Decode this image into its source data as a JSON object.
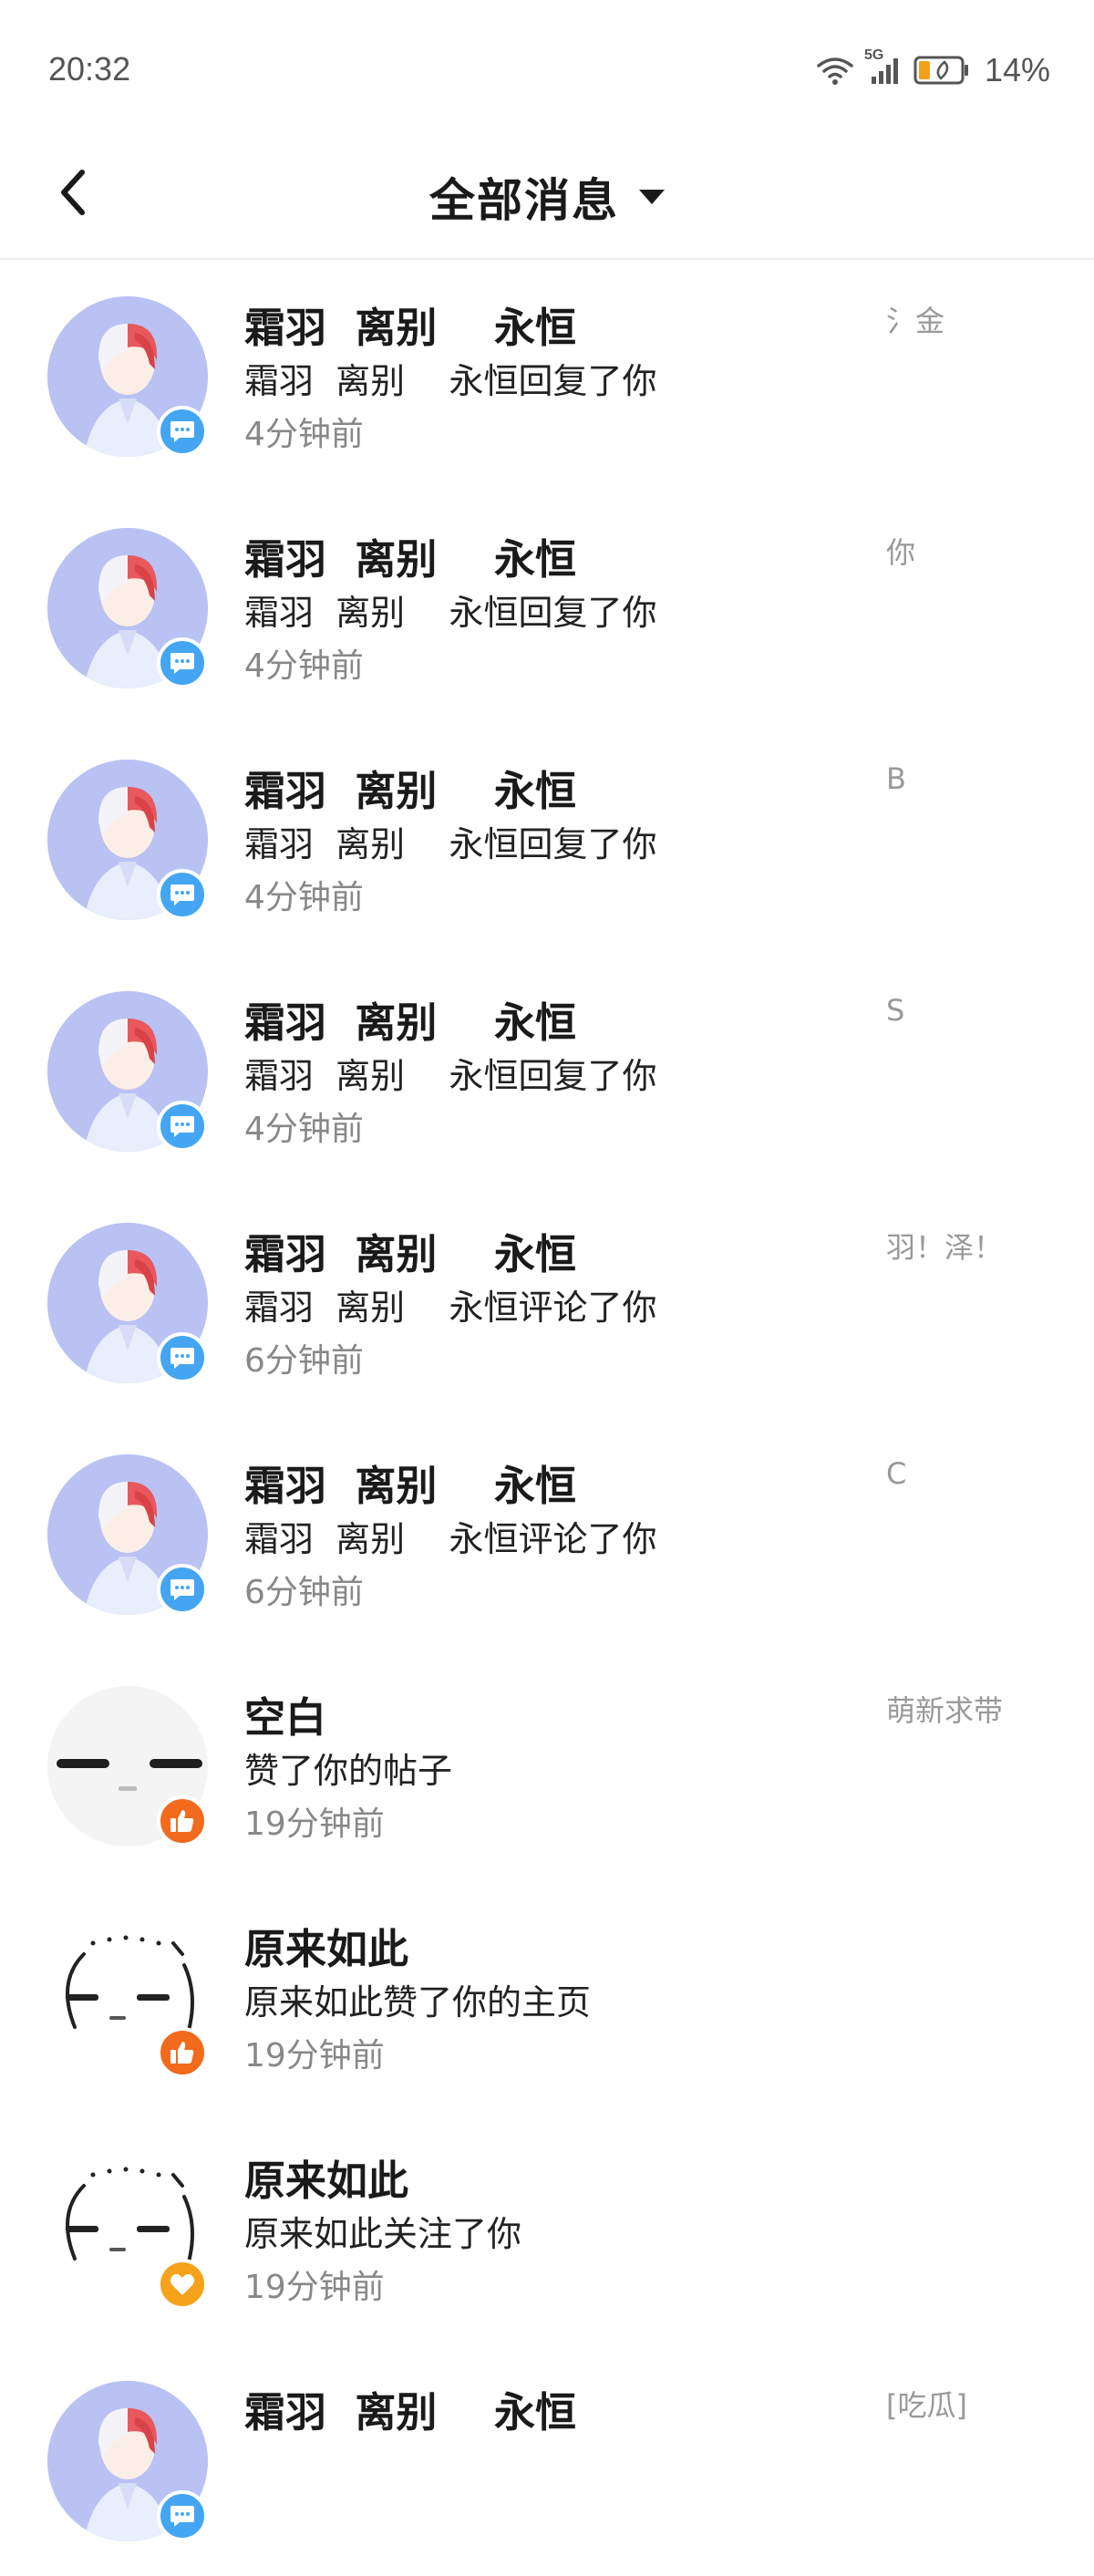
{
  "status_bar": {
    "time": "20:32",
    "network": "5G",
    "battery": "14%"
  },
  "header": {
    "title": "全部消息",
    "back_icon": "chevron-left-icon",
    "caret_icon": "caret-down-icon"
  },
  "messages": [
    {
      "name": "霜羽  离别    永恒",
      "action": "霜羽  离别    永恒回复了你",
      "time": "4分钟前",
      "preview": "氵金",
      "avatar": "anime",
      "badge": "comment"
    },
    {
      "name": "霜羽  离别    永恒",
      "action": "霜羽  离别    永恒回复了你",
      "time": "4分钟前",
      "preview": "你",
      "avatar": "anime",
      "badge": "comment"
    },
    {
      "name": "霜羽  离别    永恒",
      "action": "霜羽  离别    永恒回复了你",
      "time": "4分钟前",
      "preview": "B",
      "avatar": "anime",
      "badge": "comment"
    },
    {
      "name": "霜羽  离别    永恒",
      "action": "霜羽  离别    永恒回复了你",
      "time": "4分钟前",
      "preview": "S",
      "avatar": "anime",
      "badge": "comment"
    },
    {
      "name": "霜羽  离别    永恒",
      "action": "霜羽  离别    永恒评论了你",
      "time": "6分钟前",
      "preview": "羽！泽！",
      "avatar": "anime",
      "badge": "comment"
    },
    {
      "name": "霜羽  离别    永恒",
      "action": "霜羽  离别    永恒评论了你",
      "time": "6分钟前",
      "preview": "C",
      "avatar": "anime",
      "badge": "comment"
    },
    {
      "name": "空白",
      "action": "赞了你的帖子",
      "time": "19分钟前",
      "preview": "萌新求带",
      "avatar": "blank",
      "badge": "like"
    },
    {
      "name": "原来如此",
      "action": "原来如此赞了你的主页",
      "time": "19分钟前",
      "preview": "",
      "avatar": "face",
      "badge": "like"
    },
    {
      "name": "原来如此",
      "action": "原来如此关注了你",
      "time": "19分钟前",
      "preview": "",
      "avatar": "face",
      "badge": "follow"
    },
    {
      "name": "霜羽  离别    永恒",
      "action": "",
      "time": "",
      "preview": "[吃瓜]",
      "avatar": "anime",
      "badge": "comment"
    }
  ],
  "colors": {
    "comment_badge": "#44a6f2",
    "like_badge": "#f26a1b",
    "follow_badge": "#f6a21a",
    "anime_avatar_bg": "#b9c2f3"
  }
}
